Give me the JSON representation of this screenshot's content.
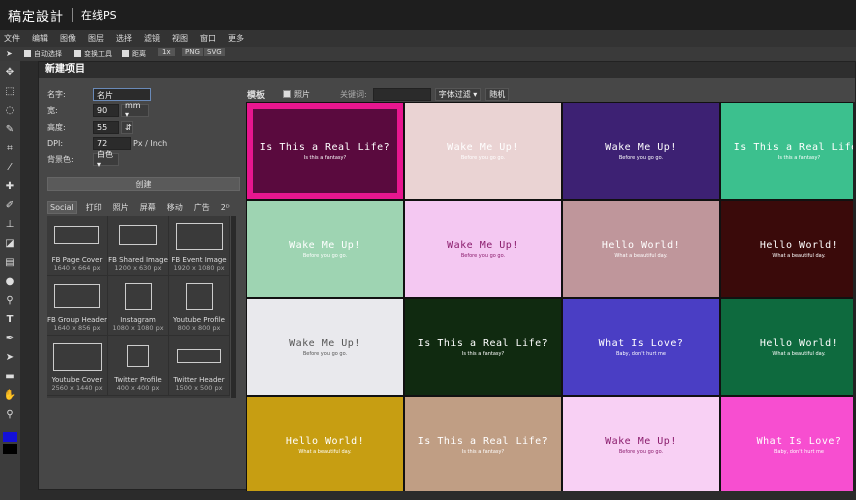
{
  "app": {
    "logo": "稿定設計",
    "subtitle": "在线PS"
  },
  "menu": [
    "文件",
    "编辑",
    "图像",
    "图层",
    "选择",
    "滤镜",
    "视图",
    "窗口",
    "更多"
  ],
  "options": {
    "auto_select": "自动选择",
    "transform": "变换工具",
    "distance": "距离",
    "zoom": "1x",
    "png": "PNG",
    "svg": "SVG"
  },
  "dialog": {
    "title": "新建项目",
    "name_label": "名字:",
    "name_value": "名片",
    "width_label": "宽:",
    "width_value": "90",
    "width_unit": "mm ▾",
    "height_label": "高度:",
    "height_value": "55",
    "lock": "⇵",
    "dpi_label": "DPI:",
    "dpi_value": "72",
    "dpi_unit": "Px / Inch",
    "bg_label": "背景色:",
    "bg_value": "白色 ▾",
    "create_label": "创建",
    "categories": [
      "Social",
      "打印",
      "照片",
      "屏幕",
      "移动",
      "广告",
      "2ᴰ"
    ],
    "presets": [
      {
        "name": "FB Page Cover",
        "size": "1640 x 664 px"
      },
      {
        "name": "FB Shared Image",
        "size": "1200 x 630 px"
      },
      {
        "name": "FB Event Image",
        "size": "1920 x 1080 px"
      },
      {
        "name": "FB Group Header",
        "size": "1640 x 856 px"
      },
      {
        "name": "Instagram",
        "size": "1080 x 1080 px"
      },
      {
        "name": "Youtube Profile",
        "size": "800 x 800 px"
      },
      {
        "name": "Youtube Cover",
        "size": "2560 x 1440 px"
      },
      {
        "name": "Twitter Profile",
        "size": "400 x 400 px"
      },
      {
        "name": "Twitter Header",
        "size": "1500 x 500 px"
      }
    ],
    "templates_label": "模板",
    "photos_label": "照片",
    "keyword_label": "关键词:",
    "keyword_value": "",
    "font_filter": "字体过滤 ▾",
    "random": "随机"
  },
  "templates": [
    {
      "title": "Is This a Real Life?",
      "sub": "Is this a fantasy?",
      "bg": "#5a0a3e",
      "fg": "#ffffff",
      "selected": true
    },
    {
      "title": "Wake Me Up!",
      "sub": "Before you go go.",
      "bg": "#ead3d3",
      "fg": "#ffffff"
    },
    {
      "title": "Wake Me Up!",
      "sub": "Before you go go.",
      "bg": "#3d2173",
      "fg": "#ffffff"
    },
    {
      "title": "Is This a Real Life?",
      "sub": "Is this a fantasy?",
      "bg": "#3cc08e",
      "fg": "#ffffff"
    },
    {
      "title": "Wake Me Up!",
      "sub": "Before you go go.",
      "bg": "#9ed4b2",
      "fg": "#ffffff"
    },
    {
      "title": "Wake Me Up!",
      "sub": "Before you go go.",
      "bg": "#f4c8f2",
      "fg": "#8a1c6c"
    },
    {
      "title": "Hello World!",
      "sub": "What a beautiful day.",
      "bg": "#bf969b",
      "fg": "#ffffff"
    },
    {
      "title": "Hello World!",
      "sub": "What a beautiful day.",
      "bg": "#3a0a0a",
      "fg": "#ffffff"
    },
    {
      "title": "Wake Me Up!",
      "sub": "Before you go go.",
      "bg": "#e9e9ed",
      "fg": "#555555"
    },
    {
      "title": "Is This a Real Life?",
      "sub": "Is this a fantasy?",
      "bg": "#102a10",
      "fg": "#ffffff"
    },
    {
      "title": "What Is Love?",
      "sub": "Baby, don't hurt me",
      "bg": "#4a3ec4",
      "fg": "#ffffff"
    },
    {
      "title": "Hello World!",
      "sub": "What a beautiful day.",
      "bg": "#0e6a3e",
      "fg": "#ffffff"
    },
    {
      "title": "Hello World!",
      "sub": "What a beautiful day.",
      "bg": "#c79e12",
      "fg": "#ffffff"
    },
    {
      "title": "Is This a Real Life?",
      "sub": "Is this a fantasy?",
      "bg": "#c09e84",
      "fg": "#ffffff"
    },
    {
      "title": "Wake Me Up!",
      "sub": "Before you go go.",
      "bg": "#f8d0f4",
      "fg": "#8a1c6c"
    },
    {
      "title": "What Is Love?",
      "sub": "Baby, don't hurt me",
      "bg": "#f74ed0",
      "fg": "#ffffff"
    }
  ]
}
